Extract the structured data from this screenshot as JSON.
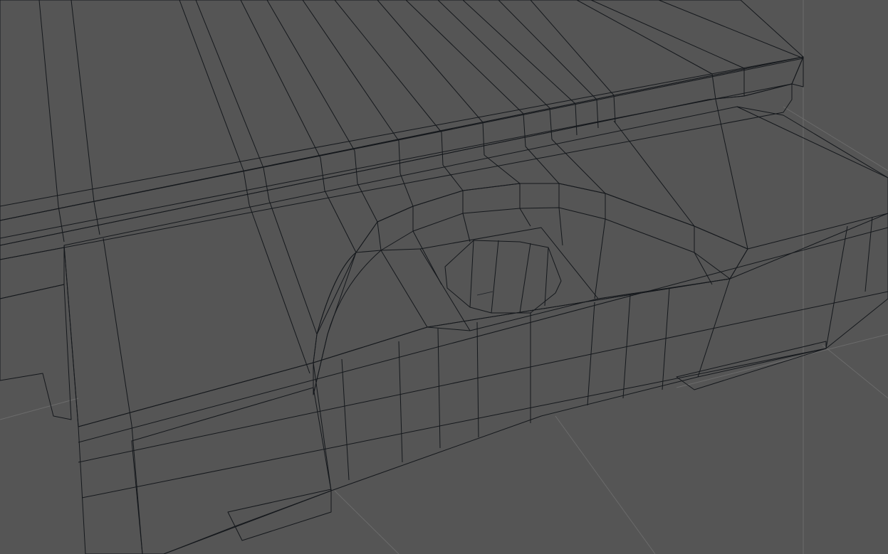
{
  "viewport": {
    "background_color": "#555555",
    "grid_color": "#6b6b6b",
    "mesh_top_color": "#4a5059",
    "mesh_side_color": "#3c4048",
    "mesh_dark_color": "#2b2f36",
    "wire_color": "#15181c"
  }
}
